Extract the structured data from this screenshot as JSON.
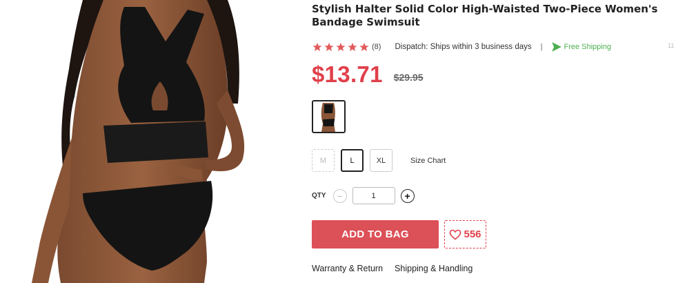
{
  "product": {
    "title": "Stylish Halter Solid Color High-Waisted Two-Piece Women's Bandage Swimsuit",
    "rating": 5,
    "review_count": "(8)",
    "dispatch": "Dispatch: Ships within 3 business days",
    "separator": "|",
    "free_shipping": "Free Shipping",
    "trailing_text": "11",
    "price": "$13.71",
    "old_price": "$29.95"
  },
  "sizes": {
    "options": [
      {
        "label": "M",
        "state": "disabled"
      },
      {
        "label": "L",
        "state": "selected"
      },
      {
        "label": "XL",
        "state": "available"
      }
    ],
    "size_chart_label": "Size Chart"
  },
  "quantity": {
    "label": "QTY",
    "value": "1",
    "minus_symbol": "−",
    "plus_symbol": "+"
  },
  "actions": {
    "add_to_bag": "ADD TO BAG",
    "wishlist_count": "556"
  },
  "links": {
    "warranty": "Warranty & Return",
    "shipping": "Shipping & Handling"
  },
  "colors": {
    "price_red": "#e0404a",
    "button_red": "#dc5057",
    "free_ship_green": "#4caf50",
    "star_red": "#e25b5b"
  },
  "icons": {
    "star": "star-icon",
    "shipping": "plane-icon",
    "heart": "heart-icon"
  }
}
